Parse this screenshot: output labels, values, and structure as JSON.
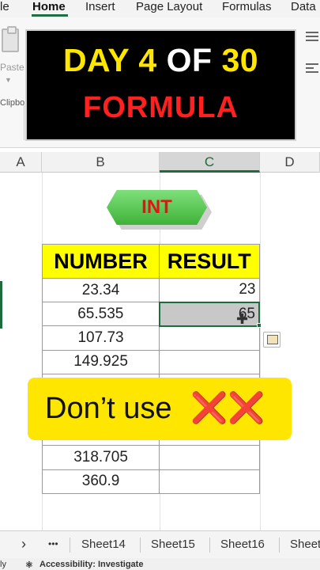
{
  "ribbon": {
    "tabs": [
      "le",
      "Home",
      "Insert",
      "Page Layout",
      "Formulas",
      "Data"
    ],
    "active_tab": "Home",
    "paste_label": "Paste",
    "clipboard_label": "Clipbo"
  },
  "banner": {
    "line1_day": "DAY 4",
    "line1_of": "OF",
    "line1_num": "30",
    "line2": "FORMULA"
  },
  "columns": [
    "A",
    "B",
    "C",
    "D"
  ],
  "int_label": "INT",
  "table": {
    "headers": [
      "NUMBER",
      "RESULT"
    ],
    "rows": [
      [
        "23.34",
        "23"
      ],
      [
        "65.535",
        "65"
      ],
      [
        "107.73",
        ""
      ],
      [
        "149.925",
        ""
      ],
      [
        "",
        ""
      ],
      [
        "",
        ""
      ],
      [
        "",
        ""
      ],
      [
        "318.705",
        ""
      ],
      [
        "360.9",
        ""
      ]
    ]
  },
  "overlay": {
    "text": "Don’t use",
    "marks": "❌❌"
  },
  "sheets": {
    "nav_next": "›",
    "more": "•••",
    "tabs": [
      "Sheet14",
      "Sheet15",
      "Sheet16",
      "Sheet"
    ]
  },
  "status": {
    "left": "ly",
    "accessibility": "Accessibility: Investigate"
  }
}
